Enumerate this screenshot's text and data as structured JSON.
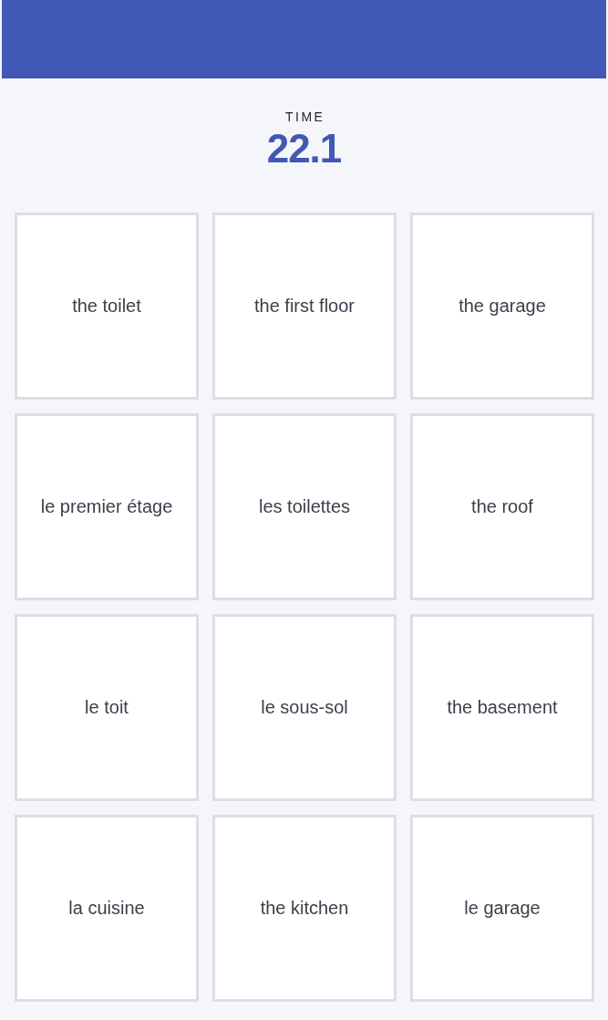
{
  "timer": {
    "label": "TIME",
    "value": "22.1"
  },
  "cards": [
    {
      "text": "the toilet",
      "selected": false
    },
    {
      "text": "the first floor",
      "selected": false
    },
    {
      "text": "the garage",
      "selected": false
    },
    {
      "text": "le premier étage",
      "selected": false
    },
    {
      "text": "les toilettes",
      "selected": false
    },
    {
      "text": "the roof",
      "selected": false
    },
    {
      "text": "le toit",
      "selected": false
    },
    {
      "text": "le sous-sol",
      "selected": false
    },
    {
      "text": "the basement",
      "selected": false
    },
    {
      "text": "la cuisine",
      "selected": false
    },
    {
      "text": "the kitchen",
      "selected": false
    },
    {
      "text": "le garage",
      "selected": false
    }
  ]
}
